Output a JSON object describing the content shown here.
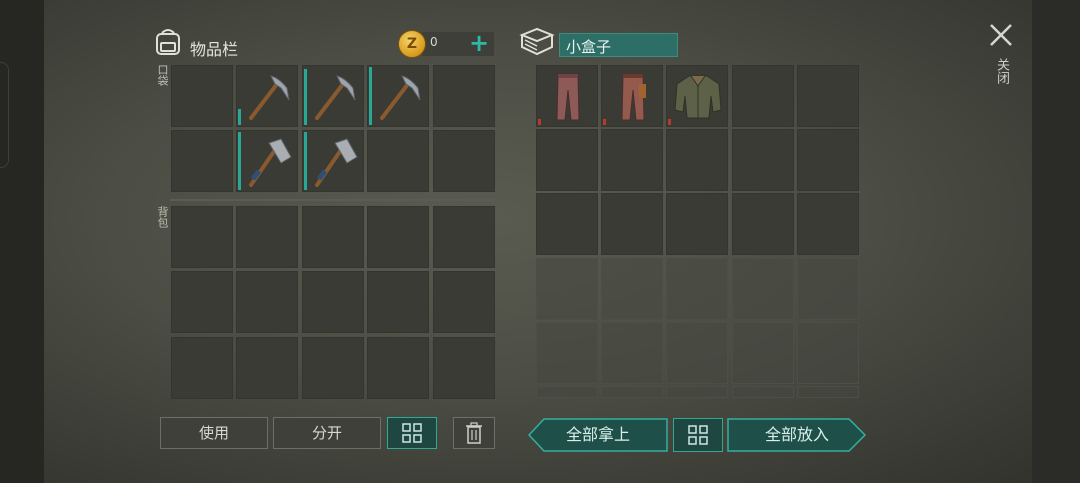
{
  "inventory": {
    "title": "物品栏",
    "coins": "0",
    "coin_symbol": "Z",
    "pocket_label": "口袋",
    "backpack_label": "背包"
  },
  "container": {
    "title": "小盒子"
  },
  "close_label": "关闭",
  "buttons": {
    "use": "使用",
    "split": "分开",
    "take_all": "全部拿上",
    "put_all": "全部放入"
  },
  "pocket_items": [
    "",
    "pickaxe",
    "pickaxe",
    "pickaxe",
    "",
    "",
    "axe",
    "axe",
    "",
    ""
  ],
  "container_items": [
    "pants",
    "pants-belt",
    "jacket",
    "",
    ""
  ],
  "colors": {
    "accent": "#2fb8a6",
    "durability": "#2aa896",
    "damaged": "#b5392f"
  }
}
